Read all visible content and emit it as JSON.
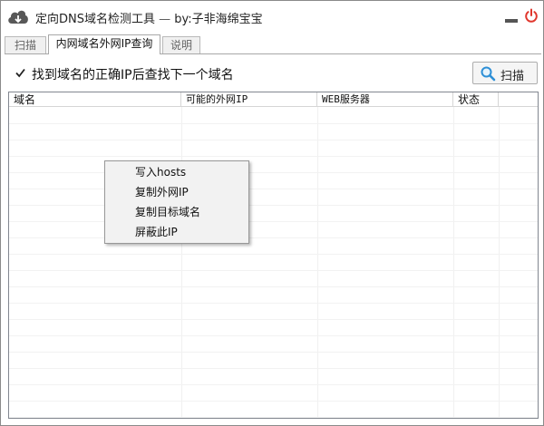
{
  "app": {
    "title": "定向DNS域名检测工具",
    "title_sep": " — ",
    "author": "by:子非海绵宝宝",
    "accent_color": "#e0362c"
  },
  "tabs": [
    {
      "label": "扫描",
      "active": false
    },
    {
      "label": "内网域名外网IP查询",
      "active": true
    },
    {
      "label": "说明",
      "active": false
    }
  ],
  "options": {
    "checkbox_checked": true,
    "checkbox_label": "找到域名的正确IP后查找下一个域名"
  },
  "scan_button": {
    "label": "扫描",
    "icon": "magnifier-icon"
  },
  "table": {
    "columns": [
      "域名",
      "可能的外网IP",
      "WEB服务器",
      "状态"
    ],
    "rows": []
  },
  "context_menu": {
    "items": [
      "写入hosts",
      "复制外网IP",
      "复制目标域名",
      "屏蔽此IP"
    ]
  }
}
